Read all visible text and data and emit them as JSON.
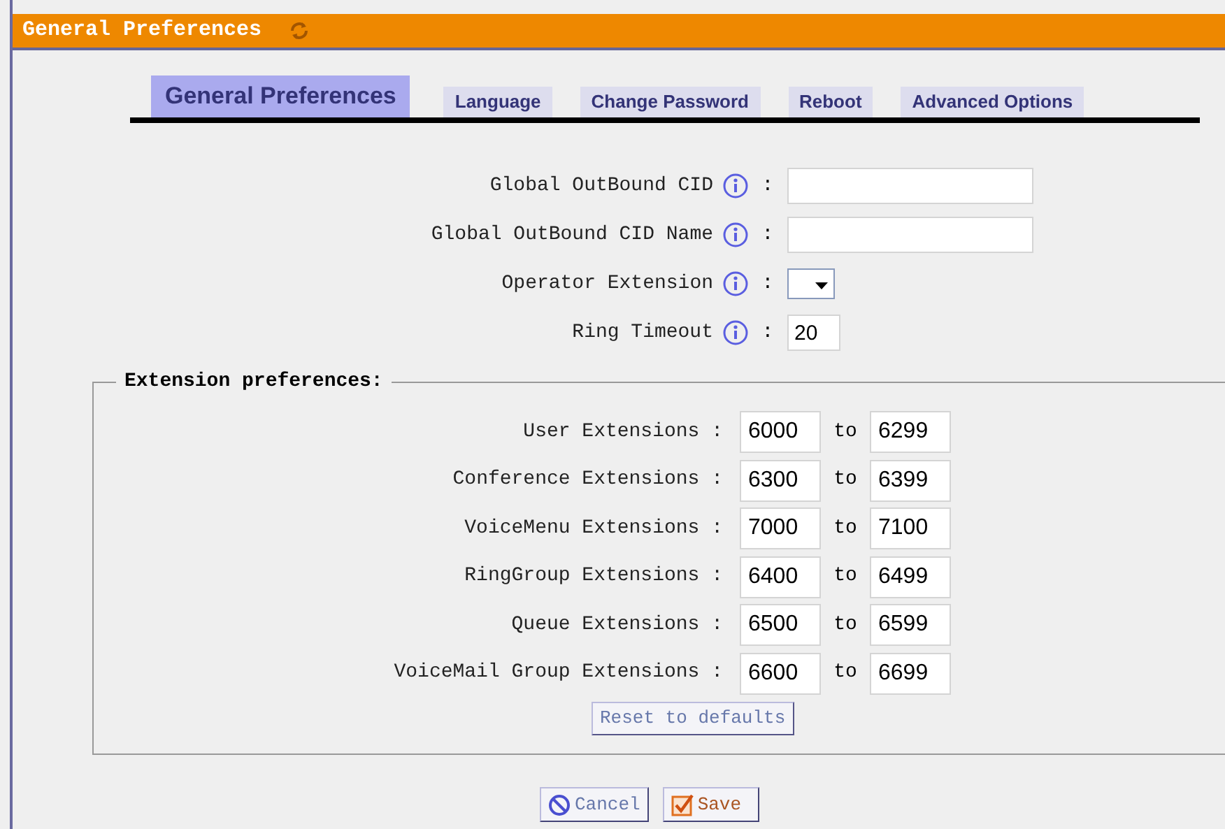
{
  "header": {
    "title": "General Preferences"
  },
  "tabs": [
    {
      "label": "General Preferences",
      "selected": true
    },
    {
      "label": "Language",
      "selected": false
    },
    {
      "label": "Change Password",
      "selected": false
    },
    {
      "label": "Reboot",
      "selected": false
    },
    {
      "label": "Advanced Options",
      "selected": false
    }
  ],
  "fields": [
    {
      "label": "Global OutBound CID",
      "colon": ":",
      "kind": "text"
    },
    {
      "label": "Global OutBound CID Name",
      "colon": ":",
      "kind": "text"
    },
    {
      "label": "Operator Extension",
      "colon": ":",
      "kind": "select"
    },
    {
      "label": "Ring Timeout",
      "colon": ":",
      "kind": "short",
      "value": "20"
    }
  ],
  "extension_preferences": {
    "title": "Extension preferences:",
    "rows": [
      {
        "label": "User Extensions :",
        "from": "6000",
        "separator": "to",
        "to": "6299"
      },
      {
        "label": "Conference Extensions :",
        "from": "6300",
        "separator": "to",
        "to": "6399"
      },
      {
        "label": "VoiceMenu Extensions :",
        "from": "7000",
        "separator": "to",
        "to": "7100"
      },
      {
        "label": "RingGroup Extensions :",
        "from": "6400",
        "separator": "to",
        "to": "6499"
      },
      {
        "label": "Queue Extensions :",
        "from": "6500",
        "separator": "to",
        "to": "6599"
      },
      {
        "label": "VoiceMail Group Extensions :",
        "from": "6600",
        "separator": "to",
        "to": "6699"
      }
    ],
    "reset_button": "Reset to defaults"
  },
  "buttons": [
    {
      "label": "Cancel",
      "kind": "cancel"
    },
    {
      "label": "Save",
      "kind": "save"
    }
  ]
}
